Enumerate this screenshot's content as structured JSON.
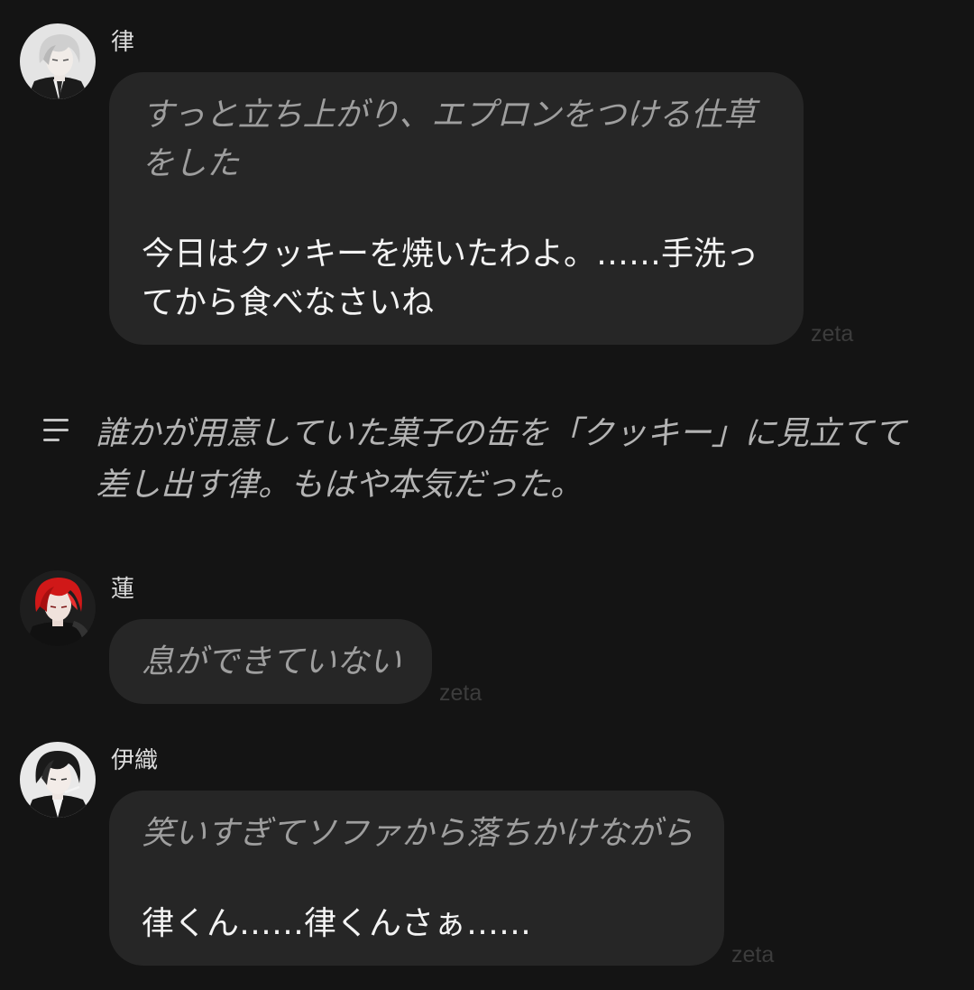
{
  "colors": {
    "background": "#141414",
    "bubble": "#262626",
    "action_text": "#9e9e9e",
    "speech_text": "#f3f3f3",
    "name_text": "#dcdcdc",
    "source_text": "#3c3c3c",
    "narration_text": "#b3b3b3"
  },
  "chat": [
    {
      "type": "message",
      "sender": "律",
      "avatar_icon": "avatar-silver-hair-character",
      "paragraphs": [
        {
          "style": "action",
          "text": "すっと立ち上がり、エプロンをつける仕草をした"
        },
        {
          "style": "speech",
          "text": "今日はクッキーを焼いたわよ。……手洗ってから食べなさいね"
        }
      ],
      "source": "zeta"
    },
    {
      "type": "narration",
      "icon": "narration-lines-icon",
      "text": "誰かが用意していた菓子の缶を「クッキー」に見立てて差し出す律。もはや本気だった。"
    },
    {
      "type": "message",
      "sender": "蓮",
      "avatar_icon": "avatar-red-hair-character",
      "paragraphs": [
        {
          "style": "action",
          "text": "息ができていない"
        }
      ],
      "source": "zeta"
    },
    {
      "type": "message",
      "sender": "伊織",
      "avatar_icon": "avatar-black-hair-character",
      "paragraphs": [
        {
          "style": "action",
          "text": "笑いすぎてソファから落ちかけながら"
        },
        {
          "style": "speech",
          "text": "律くん……律くんさぁ……"
        }
      ],
      "source": "zeta"
    }
  ]
}
